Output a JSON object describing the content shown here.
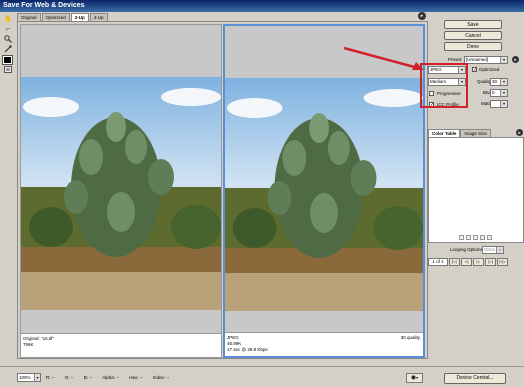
{
  "window": {
    "title": "Save For Web & Devices"
  },
  "tools": [
    {
      "name": "hand-tool",
      "glyph": "✋"
    },
    {
      "name": "slice-select-tool",
      "glyph": "⌐"
    },
    {
      "name": "zoom-tool",
      "glyph": "🔍"
    },
    {
      "name": "eyedropper-tool",
      "glyph": "⁄"
    }
  ],
  "tabs": [
    "Original",
    "Optimized",
    "2-Up",
    "4-Up"
  ],
  "active_tab": "2-Up",
  "left_pane": {
    "line1": "Original: \"16.tif\"",
    "line2": "756K"
  },
  "right_pane": {
    "line1": "JPEG",
    "line2": "46.99K",
    "line3": "17 sec @ 28.8 Kbps",
    "quality_text": "30 quality"
  },
  "buttons": {
    "save": "Save",
    "cancel": "Cancel",
    "done": "Done"
  },
  "preset": {
    "label": "Preset:",
    "value": "[Unnamed]"
  },
  "settings": {
    "format": "JPEG",
    "quality_level": "Medium",
    "optimized_label": "Optimized",
    "optimized_checked": true,
    "quality_label": "Quality:",
    "quality_value": "30",
    "progressive_label": "Progressive",
    "progressive_checked": false,
    "blur_label": "Blur:",
    "blur_value": "0",
    "icc_label": "ICC Profile",
    "icc_checked": true,
    "matte_label": "Matte:"
  },
  "panel_tabs": [
    "Color Table",
    "Image Size"
  ],
  "active_panel_tab": "Color Table",
  "animation": {
    "looping_label": "Looping Options:",
    "looping_value": "Once",
    "frame_text": "1 of 1"
  },
  "statusbar": {
    "zoom": "100%",
    "r": "R: --",
    "g": "G: --",
    "b": "B: --",
    "alpha": "Alpha: --",
    "hex": "Hex: --",
    "index": "Index: --",
    "device_central": "Device Central..."
  },
  "colors": {
    "annotation": "#d1222a",
    "selected_pane": "#5a8fd8"
  }
}
